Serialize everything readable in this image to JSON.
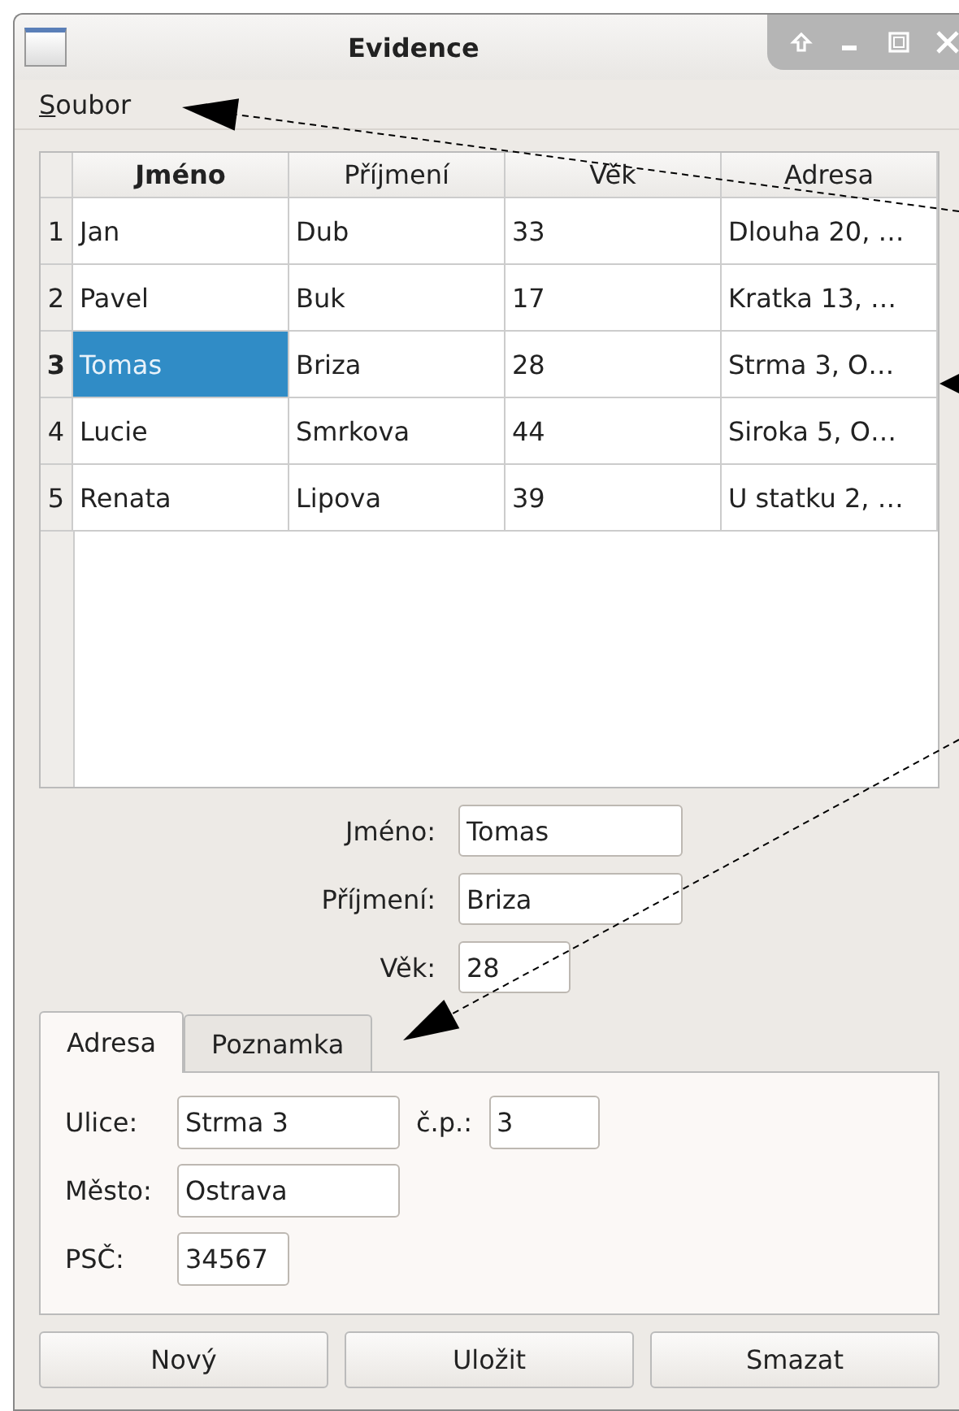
{
  "window": {
    "title": "Evidence"
  },
  "menu": [
    {
      "label": "Soubor"
    }
  ],
  "table": {
    "columns": [
      {
        "label": "Jméno",
        "selected": true
      },
      {
        "label": "Příjmení",
        "selected": false
      },
      {
        "label": "Věk",
        "selected": false
      },
      {
        "label": "Adresa",
        "selected": false
      }
    ],
    "rows": [
      {
        "header": "1",
        "selected": false,
        "cells": [
          "Jan",
          "Dub",
          "33",
          "Dlouha 20, …"
        ]
      },
      {
        "header": "2",
        "selected": false,
        "cells": [
          "Pavel",
          "Buk",
          "17",
          "Kratka 13, …"
        ]
      },
      {
        "header": "3",
        "selected": true,
        "cells": [
          "Tomas",
          "Briza",
          "28",
          "Strma 3, O…"
        ]
      },
      {
        "header": "4",
        "selected": false,
        "cells": [
          "Lucie",
          "Smrkova",
          "44",
          "Siroka 5, O…"
        ]
      },
      {
        "header": "5",
        "selected": false,
        "cells": [
          "Renata",
          "Lipova",
          "39",
          "U statku 2, …"
        ]
      }
    ]
  },
  "form": [
    {
      "label": "Jméno:",
      "value": "Tomas",
      "kind": "wide"
    },
    {
      "label": "Příjmení:",
      "value": "Briza",
      "kind": "wide"
    },
    {
      "label": "Věk:",
      "value": "28",
      "kind": "narrow"
    }
  ],
  "tabs": [
    {
      "label": "Adresa",
      "selected": true
    },
    {
      "label": "Poznamka",
      "selected": false
    }
  ],
  "address": {
    "street_label": "Ulice:",
    "street": "Strma 3",
    "number_label": "č.p.:",
    "number": "3",
    "city_label": "Město:",
    "city": "Ostrava",
    "zip_label": "PSČ:",
    "zip": "34567"
  },
  "buttons": [
    {
      "label": "Nový"
    },
    {
      "label": "Uložit"
    },
    {
      "label": "Smazat"
    }
  ]
}
